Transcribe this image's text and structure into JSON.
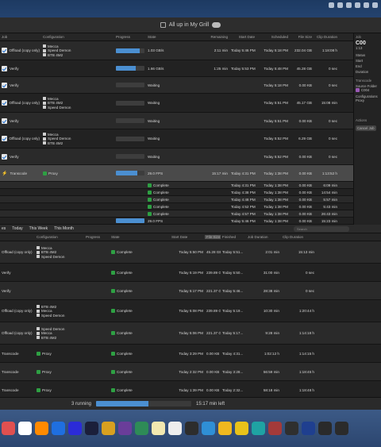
{
  "window": {
    "title": "All up in My Grill"
  },
  "queue": {
    "headers": [
      "Job",
      "Configuration",
      "Progress",
      "State",
      "Remaining",
      "Start Date",
      "Scheduled",
      "File Size",
      "Clip Duration"
    ],
    "rows": [
      {
        "kind": "Offload (copy only)",
        "icon": "offload",
        "configs": [
          "Mecca",
          "Speed Demon",
          "BTB 4M2"
        ],
        "progress": 0.82,
        "state": "1.03 GB/s",
        "remaining": "2:11 min",
        "start": "Today 5:46 PM",
        "scheduled": "Today 5:18 PM",
        "size": "232.04 GB",
        "dur": "1:18:08 h"
      },
      {
        "kind": "Verify",
        "icon": "verify",
        "configs": [],
        "progress": 0.7,
        "state": "1.66 GB/s",
        "remaining": "1:25 min",
        "start": "Today 5:53 PM",
        "scheduled": "Today 5:48 PM",
        "size": "45.28 GB",
        "dur": "0 sec"
      },
      {
        "kind": "Verify",
        "icon": "verify",
        "configs": [],
        "progress": 0.0,
        "state": "Waiting",
        "remaining": "",
        "start": "",
        "scheduled": "Today 5:18 PM",
        "size": "0.00 KB",
        "dur": "0 sec"
      },
      {
        "kind": "Offload (copy only)",
        "icon": "offload",
        "configs": [
          "Mecca",
          "BTB 4M2",
          "Speed Demon"
        ],
        "progress": 0.0,
        "state": "Waiting",
        "remaining": "",
        "start": "",
        "scheduled": "Today 5:51 PM",
        "size": "45.17 GB",
        "dur": "15:08 min"
      },
      {
        "kind": "Verify",
        "icon": "verify",
        "configs": [],
        "progress": 0.0,
        "state": "Waiting",
        "remaining": "",
        "start": "",
        "scheduled": "Today 5:51 PM",
        "size": "0.00 KB",
        "dur": "0 sec"
      },
      {
        "kind": "Offload (copy only)",
        "icon": "offload",
        "configs": [
          "Mecca",
          "Speed Demon",
          "BTB 4M2"
        ],
        "progress": 0.0,
        "state": "Waiting",
        "remaining": "",
        "start": "",
        "scheduled": "Today 5:52 PM",
        "size": "6.29 GB",
        "dur": "0 sec"
      },
      {
        "kind": "Verify",
        "icon": "verify",
        "configs": [],
        "progress": 0.0,
        "state": "Waiting",
        "remaining": "",
        "start": "",
        "scheduled": "Today 5:52 PM",
        "size": "0.00 KB",
        "dur": "0 sec"
      },
      {
        "kind": "Transcode",
        "icon": "transcode",
        "configs": [
          "Proxy"
        ],
        "progress": 0.75,
        "state": "29.0 FPS",
        "remaining": "15:17 min",
        "start": "Today 4:31 PM",
        "scheduled": "Today 1:38 PM",
        "size": "0.00 KB",
        "dur": "1:13:52 h",
        "selected": true
      }
    ],
    "subrows": [
      {
        "state": "Complete",
        "start": "Today 4:31 PM",
        "sched": "Today 1:38 PM",
        "size": "0.00 KB",
        "dur": "6:09 min"
      },
      {
        "state": "Complete",
        "start": "Today 4:38 PM",
        "sched": "Today 1:38 PM",
        "size": "0.00 KB",
        "dur": "14:54 min"
      },
      {
        "state": "Complete",
        "start": "Today 4:48 PM",
        "sched": "Today 1:38 PM",
        "size": "0.00 KB",
        "dur": "5:57 min"
      },
      {
        "state": "Complete",
        "start": "Today 4:52 PM",
        "sched": "Today 1:38 PM",
        "size": "0.00 KB",
        "dur": "5:43 min"
      },
      {
        "state": "Complete",
        "start": "Today 4:57 PM",
        "sched": "Today 1:38 PM",
        "size": "0.00 KB",
        "dur": "26:43 min"
      },
      {
        "state": "29.0 FPS",
        "start": "Today 5:46 PM",
        "sched": "Today 1:38 PM",
        "size": "0.00 KB",
        "dur": "15:23 min"
      }
    ]
  },
  "rightpanel": {
    "title": "Job",
    "name": "C00",
    "sub": "1:13",
    "labels": [
      "Status",
      "Start",
      "End",
      "Duration"
    ],
    "section": "Transcode",
    "folder_label": "Source Folder",
    "folder": "C004",
    "config_label": "Configurations",
    "config": "Proxy",
    "actions_label": "Actions",
    "cancel": "Cancel Job"
  },
  "history": {
    "tabs": [
      "es",
      "Today",
      "This Week",
      "This Month"
    ],
    "search_placeholder": "Search",
    "headers": [
      "Configuration",
      "Progress",
      "State",
      "Start Date",
      "File Size",
      "Finished",
      "Job Duration",
      "Clip Duration"
    ],
    "rows": [
      {
        "kind": "Offload (copy only)",
        "configs": [
          "Mecca",
          "BTB 4M2",
          "Speed Demon"
        ],
        "state": "Complete",
        "start": "Today 5:50 PM",
        "size": "45.28 GB",
        "fin": "Today 5:51...",
        "jobdur": "2:01 min",
        "clipdur": "15:13 min"
      },
      {
        "kind": "Verify",
        "configs": [],
        "state": "Complete",
        "start": "Today 5:19 PM",
        "size": "239.89 GB",
        "fin": "Today 5:50...",
        "jobdur": "31:00 min",
        "clipdur": "0 sec"
      },
      {
        "kind": "Verify",
        "configs": [],
        "state": "Complete",
        "start": "Today 5:17 PM",
        "size": "221.37 GB",
        "fin": "Today 5:46...",
        "jobdur": "28:38 min",
        "clipdur": "0 sec"
      },
      {
        "kind": "Offload (copy only)",
        "configs": [
          "BTB 4M2",
          "Mecca",
          "Speed Demon"
        ],
        "state": "Complete",
        "start": "Today 5:08 PM",
        "size": "239.89 GB",
        "fin": "Today 5:19...",
        "jobdur": "10:30 min",
        "clipdur": "1:20:44 h"
      },
      {
        "kind": "Offload (copy only)",
        "configs": [
          "Speed Demon",
          "Mecca",
          "BTB 4M2"
        ],
        "state": "Complete",
        "start": "Today 5:06 PM",
        "size": "221.37 GB",
        "fin": "Today 5:17...",
        "jobdur": "9:28 min",
        "clipdur": "1:14:18 h"
      },
      {
        "kind": "Transcode",
        "configs": [
          "Proxy"
        ],
        "state": "Complete",
        "start": "Today 3:29 PM",
        "size": "0.00 KB",
        "fin": "Today 4:31...",
        "jobdur": "1:02:12 h",
        "clipdur": "1:14:15 h"
      },
      {
        "kind": "Transcode",
        "configs": [
          "Proxy"
        ],
        "state": "Complete",
        "start": "Today 2:32 PM",
        "size": "0.00 KB",
        "fin": "Today 3:28...",
        "jobdur": "56:59 min",
        "clipdur": "1:18:45 h"
      },
      {
        "kind": "Transcode",
        "configs": [
          "Proxy"
        ],
        "state": "Complete",
        "start": "Today 1:39 PM",
        "size": "0.00 KB",
        "fin": "Today 2:32...",
        "jobdur": "58:18 min",
        "clipdur": "1:18:48 h"
      }
    ]
  },
  "statusbar": {
    "running": "3 running",
    "progress": 0.55,
    "remaining": "15:17 min left"
  },
  "dock": {
    "colors": [
      "#e05050",
      "#ffffff",
      "#ff8a00",
      "#1f6fe0",
      "#2b2bd8",
      "#1b1f3a",
      "#d8a020",
      "#6a3d9a",
      "#2e8b57",
      "#f2e8b0",
      "#eeeeee",
      "#2d2d2d",
      "#2f8fd6",
      "#f0b81f",
      "#e8c21a",
      "#1fa3a3",
      "#a33a3a",
      "#2f2f2f",
      "#1f3f8f",
      "#2a2a2a",
      "#2b2b2b"
    ]
  }
}
